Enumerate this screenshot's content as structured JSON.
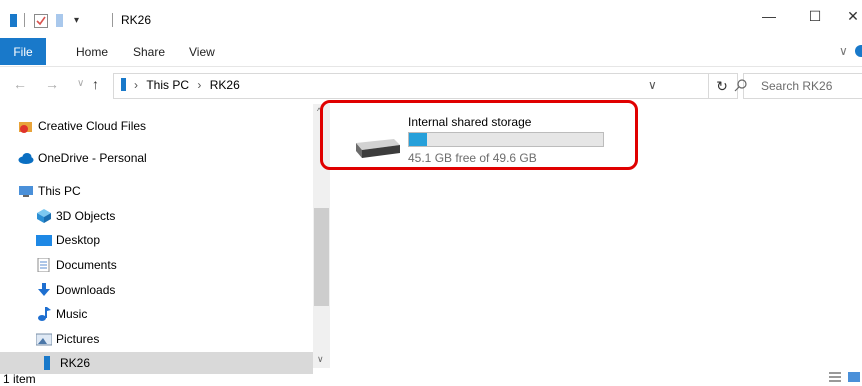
{
  "window": {
    "title": "RK26",
    "controls": [
      "—",
      "☐",
      "✕"
    ]
  },
  "ribbon": {
    "tabs": [
      "File",
      "Home",
      "Share",
      "View"
    ],
    "accent": "#1979ca"
  },
  "address": {
    "path_part1": "This PC",
    "path_part2": "RK26",
    "search_placeholder": "Search RK26"
  },
  "nav": {
    "items": [
      {
        "label": "Creative Cloud Files",
        "icon": "creative-cloud-icon"
      },
      {
        "label": "OneDrive - Personal",
        "icon": "onedrive-icon"
      },
      {
        "label": "This PC",
        "icon": "this-pc-icon"
      },
      {
        "label": "3D Objects",
        "icon": "3d-objects-icon"
      },
      {
        "label": "Desktop",
        "icon": "desktop-icon"
      },
      {
        "label": "Documents",
        "icon": "documents-icon"
      },
      {
        "label": "Downloads",
        "icon": "downloads-icon"
      },
      {
        "label": "Music",
        "icon": "music-icon"
      },
      {
        "label": "Pictures",
        "icon": "pictures-icon"
      },
      {
        "label": "RK26",
        "icon": "device-icon",
        "selected": true
      }
    ]
  },
  "content": {
    "drive": {
      "name": "Internal shared storage",
      "free_text": "45.1 GB free of 49.6 GB",
      "used_fraction": 0.091,
      "bar_color": "#26a0da"
    },
    "highlight_color": "#e00000"
  },
  "status": {
    "item_count": "1 item"
  }
}
